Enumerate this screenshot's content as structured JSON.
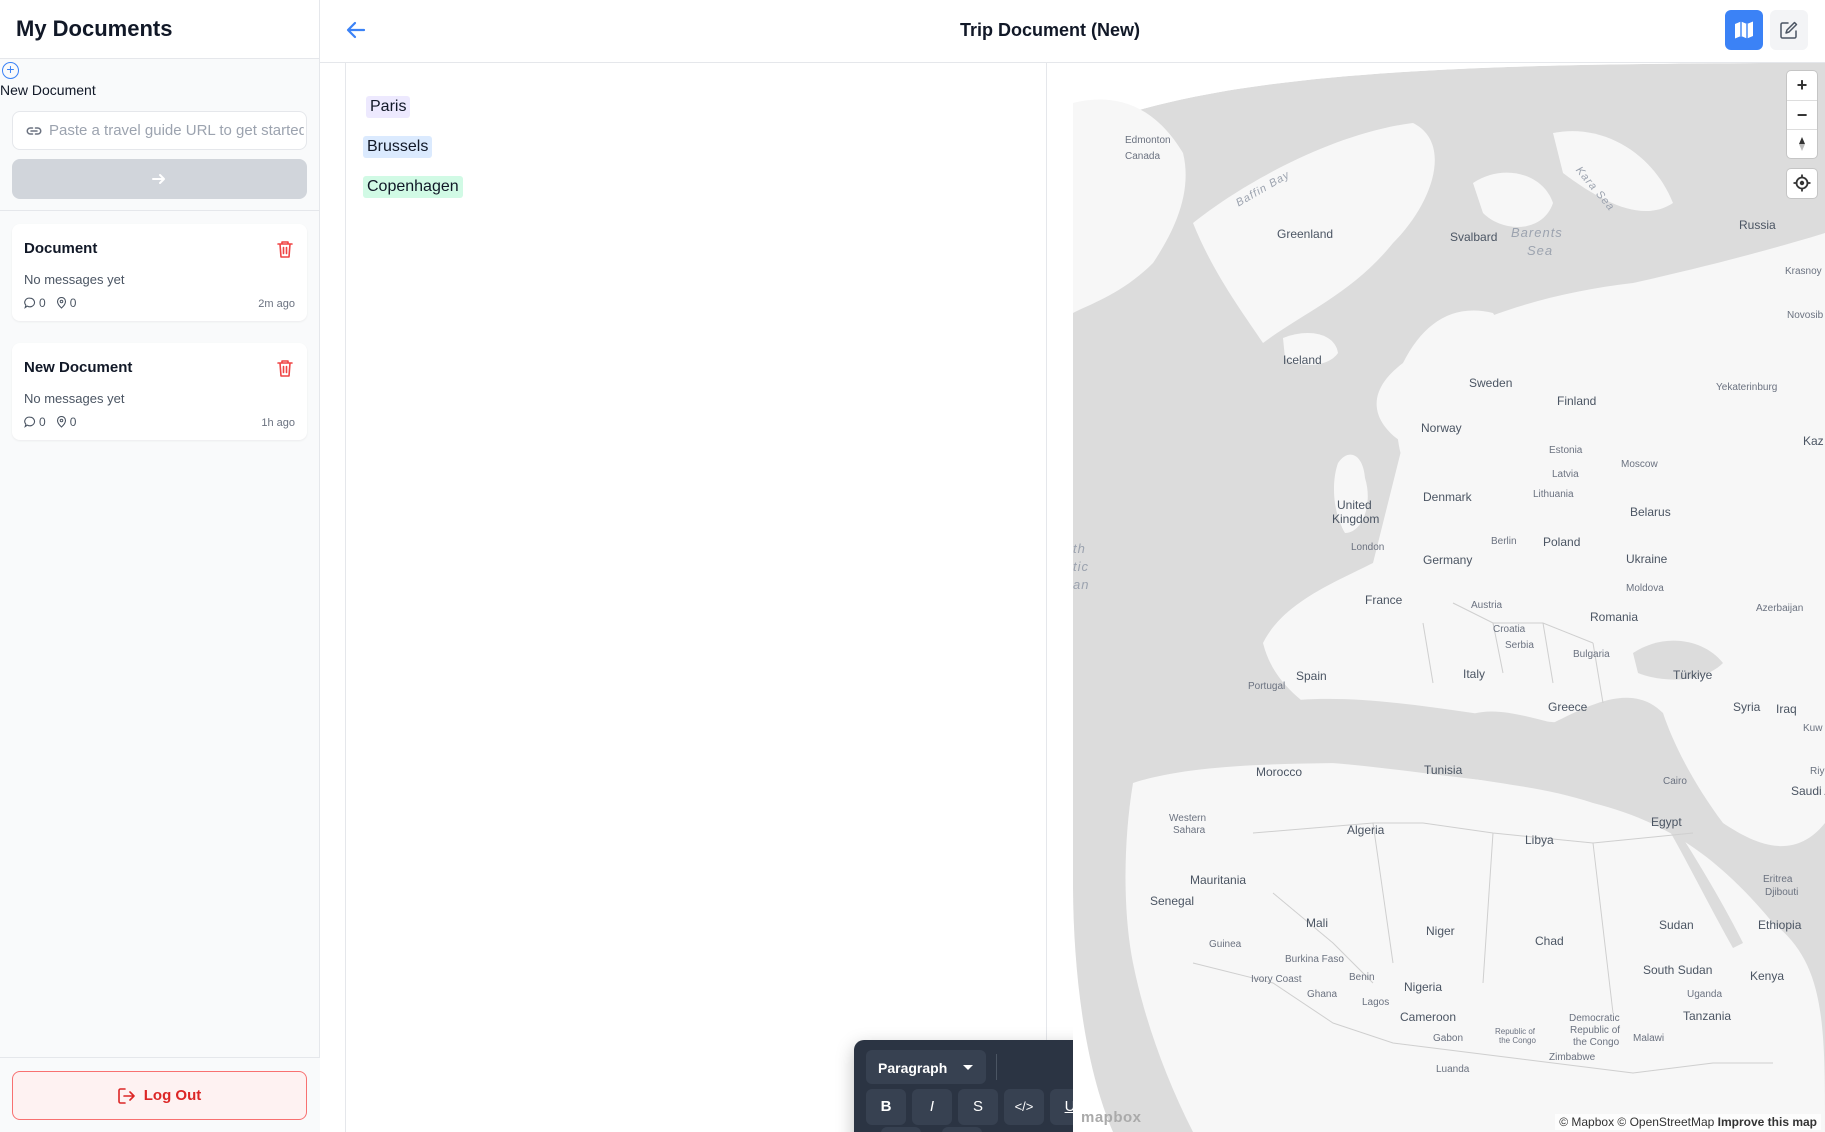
{
  "sidebar": {
    "title": "My Documents",
    "new_document_label": "New Document",
    "url_placeholder": "Paste a travel guide URL to get started",
    "documents": [
      {
        "name": "Document",
        "preview": "No messages yet",
        "messages": "0",
        "places": "0",
        "time": "2m ago"
      },
      {
        "name": "New Document",
        "preview": "No messages yet",
        "messages": "0",
        "places": "0",
        "time": "1h ago"
      }
    ],
    "logout_label": "Log Out"
  },
  "header": {
    "title": "Trip Document (New)"
  },
  "editor": {
    "places": [
      "Paris",
      "Brussels",
      "Copenhagen"
    ],
    "toolbar": {
      "block_type": "Paragraph",
      "bold": "B",
      "italic": "I",
      "strike": "S",
      "code": "</>",
      "underline": "U",
      "align": "≡"
    }
  },
  "map": {
    "labels": {
      "edmonton": "Edmonton",
      "canada": "Canada",
      "baffin_bay": "Baffin Bay",
      "greenland": "Greenland",
      "svalbard": "Svalbard",
      "barents_sea": "Barents",
      "barents_sea2": "Sea",
      "kara_sea": "Kara Sea",
      "russia": "Russia",
      "krasnoyarsk": "Krasnoy",
      "novosibirsk": "Novosib",
      "iceland": "Iceland",
      "sweden": "Sweden",
      "finland": "Finland",
      "norway": "Norway",
      "yekaterinburg": "Yekaterinburg",
      "kaz": "Kaz",
      "estonia": "Estonia",
      "latvia": "Latvia",
      "moscow": "Moscow",
      "lithuania": "Lithuania",
      "denmark": "Denmark",
      "belarus": "Belarus",
      "uk1": "United",
      "uk2": "Kingdom",
      "berlin": "Berlin",
      "poland": "Poland",
      "london": "London",
      "germany": "Germany",
      "ukraine": "Ukraine",
      "moldova": "Moldova",
      "france": "France",
      "austria": "Austria",
      "azerbaijan": "Azerbaijan",
      "croatia": "Croatia",
      "romania": "Romania",
      "serbia": "Serbia",
      "bulgaria": "Bulgaria",
      "spain": "Spain",
      "italy": "Italy",
      "turkiye": "Türkiye",
      "portugal": "Portugal",
      "greece": "Greece",
      "syria": "Syria",
      "iraq": "Iraq",
      "kuw": "Kuw",
      "morocco": "Morocco",
      "tunisia": "Tunisia",
      "riy": "Riy",
      "cairo": "Cairo",
      "saudi": "Saudi Ara",
      "ws1": "Western",
      "ws2": "Sahara",
      "algeria": "Algeria",
      "libya": "Libya",
      "egypt": "Egypt",
      "mauritania": "Mauritania",
      "eritrea": "Eritrea",
      "senegal": "Senegal",
      "djibouti": "Djibouti",
      "mali": "Mali",
      "niger": "Niger",
      "chad": "Chad",
      "sudan": "Sudan",
      "ethiopia": "Ethiopia",
      "guinea": "Guinea",
      "burkina": "Burkina Faso",
      "south_sudan": "South Sudan",
      "ivory": "Ivory Coast",
      "benin": "Benin",
      "nigeria": "Nigeria",
      "kenya": "Kenya",
      "ghana": "Ghana",
      "lagos": "Lagos",
      "uganda": "Uganda",
      "cameroon": "Cameroon",
      "drc1": "Democratic",
      "drc2": "Republic of",
      "drc3": "the Congo",
      "roc1": "Republic of",
      "roc2": "the Congo",
      "gabon": "Gabon",
      "tanzania": "Tanzania",
      "malawi": "Malawi",
      "zimbabwe": "Zimbabwe",
      "luanda": "Luanda",
      "atl1": "th",
      "atl2": "tic",
      "atl3": "an"
    },
    "logo": "mapbox",
    "attribution": "© Mapbox © OpenStreetMap",
    "improve": "Improve this map",
    "zoom_in": "+",
    "zoom_out": "−"
  },
  "colors": {
    "accent": "#3b82f6",
    "danger": "#ef4444",
    "toolbar_bg": "#2b3443"
  }
}
